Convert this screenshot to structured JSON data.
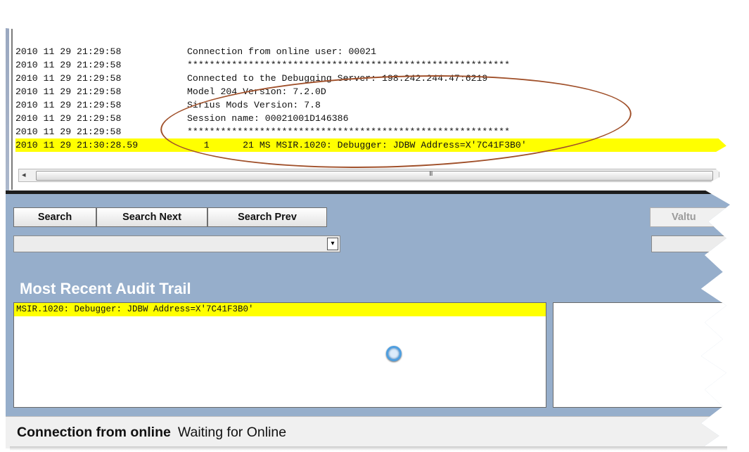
{
  "log": {
    "rows": [
      {
        "ts": "2010 11 29 21:29:58",
        "msg": "Connection from online user: 00021"
      },
      {
        "ts": "2010 11 29 21:29:58",
        "msg": "**********************************************************"
      },
      {
        "ts": "2010 11 29 21:29:58",
        "msg": "Connected to the Debugging Server: 198.242.244.47:6219"
      },
      {
        "ts": "2010 11 29 21:29:58",
        "msg": "Model 204 Version: 7.2.0D"
      },
      {
        "ts": "2010 11 29 21:29:58",
        "msg": "Sirius Mods Version: 7.8"
      },
      {
        "ts": "2010 11 29 21:29:58",
        "msg": "Session name: 00021001D146386"
      },
      {
        "ts": "2010 11 29 21:29:58",
        "msg": "**********************************************************"
      },
      {
        "ts": "2010 11 29 21:30:28.59",
        "msg": "   1      21 MS MSIR.1020: Debugger: JDBW Address=X'7C41F3B0'",
        "highlighted": true
      }
    ],
    "scroll_left_glyph": "◂",
    "scroll_grip_glyph": "III"
  },
  "toolbar": {
    "search_label": "Search",
    "search_next_label": "Search Next",
    "search_prev_label": "Search Prev",
    "value_label": "Valtu"
  },
  "combo": {
    "dropdown_glyph": "▾"
  },
  "audit": {
    "title": "Most Recent Audit Trail",
    "line": "MSIR.1020: Debugger: JDBW Address=X'7C41F3B0'"
  },
  "status": {
    "label": "Connection from online",
    "value": "Waiting for Online"
  },
  "colors": {
    "panel_blue": "#96aecb",
    "highlight": "#ffff00",
    "annotation": "#a0502a"
  }
}
